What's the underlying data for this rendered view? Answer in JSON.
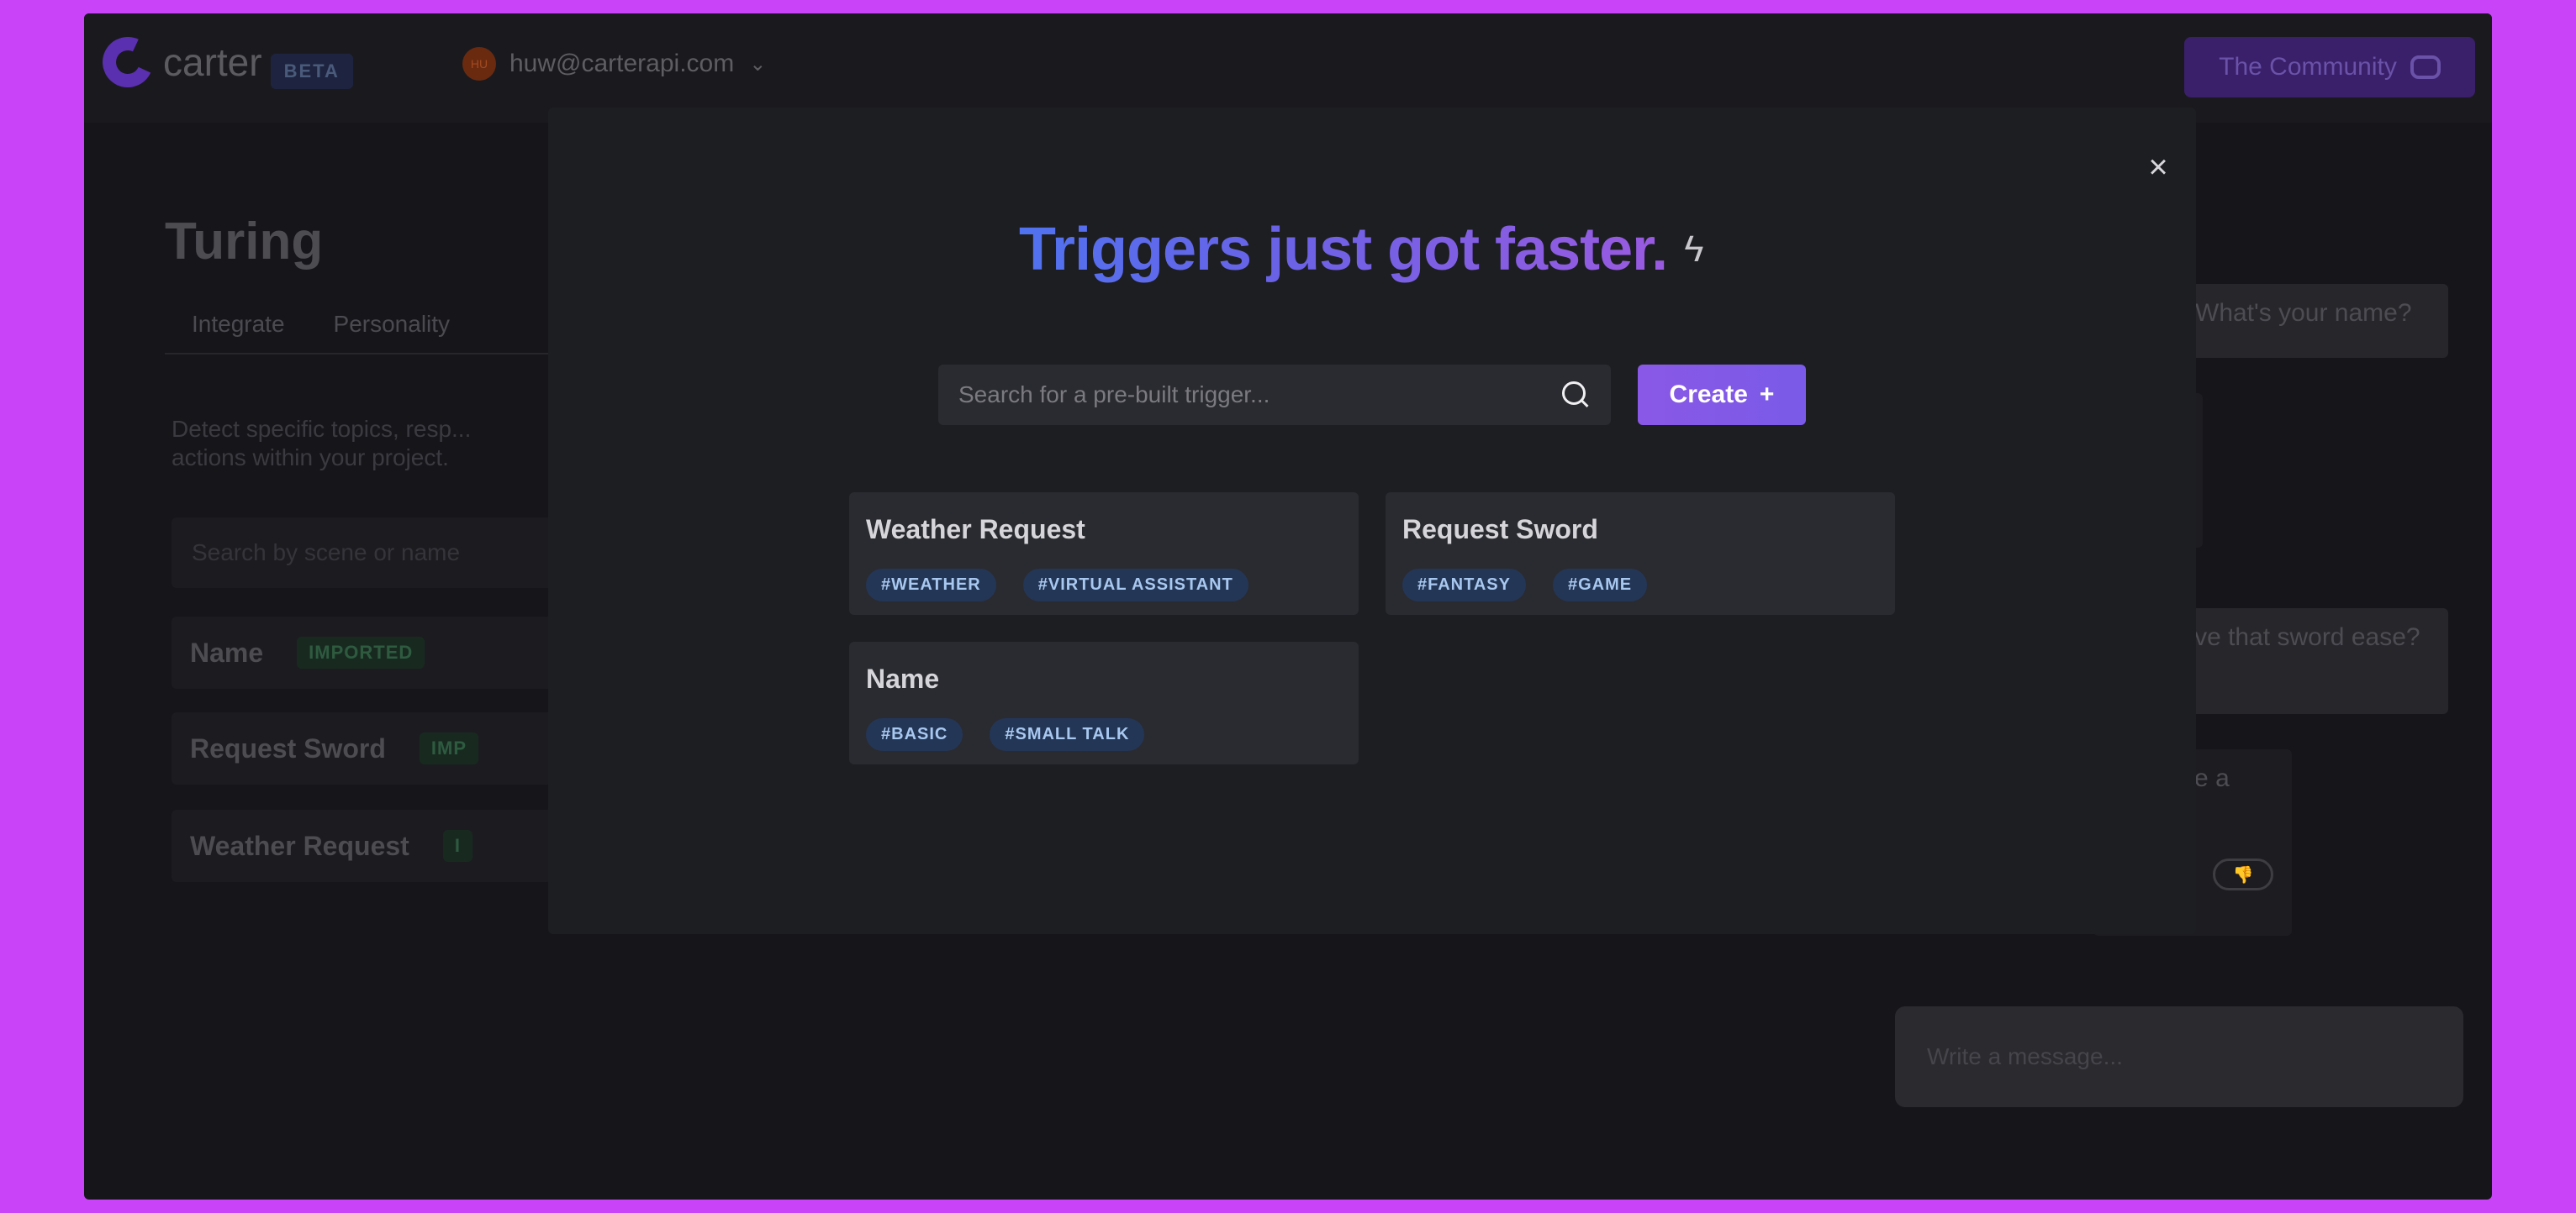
{
  "app": {
    "logo_text": "carter",
    "beta_label": "BETA",
    "account_email": "huw@carterapi.com",
    "account_avatar_initials": "HU",
    "community_label": "The Community"
  },
  "background": {
    "project_title": "Turing",
    "tabs": [
      {
        "label": "Integrate"
      },
      {
        "label": "Personality"
      }
    ],
    "description": "Detect specific topics, resp... actions within your project.",
    "search_placeholder": "Search by scene or name",
    "triggers": [
      {
        "name": "Name",
        "badge": "IMPORTED"
      },
      {
        "name": "Request Sword",
        "badge": "IMP"
      },
      {
        "name": "Weather Request",
        "badge": "I"
      }
    ],
    "chat": [
      {
        "text": "Hi! What's your name?"
      },
      {
        "text": "..."
      },
      {
        "text": "an i have that sword ease?"
      },
      {
        "text": "to do me a ugh"
      }
    ],
    "message_placeholder": "Write a message..."
  },
  "modal": {
    "headline": "Triggers just got faster.",
    "headline_icon": "lightning-bolt-icon",
    "search_placeholder": "Search for a pre-built trigger...",
    "create_label": "Create",
    "create_icon": "+",
    "cards": [
      {
        "title": "Weather Request",
        "tags": [
          "#WEATHER",
          "#VIRTUAL ASSISTANT"
        ]
      },
      {
        "title": "Request Sword",
        "tags": [
          "#FANTASY",
          "#GAME"
        ]
      },
      {
        "title": "Name",
        "tags": [
          "#BASIC",
          "#SMALL TALK"
        ]
      }
    ]
  },
  "colors": {
    "frame": "#c944f8",
    "app_bg": "#16161a",
    "modal_bg": "#1d1e22",
    "card_bg": "#2a2b30",
    "accent": "#8a58e6",
    "tag_bg": "#243656",
    "tag_text": "#a8c8f0",
    "headline_gradient_start": "#5072f0",
    "headline_gradient_end": "#9a5ae0"
  }
}
